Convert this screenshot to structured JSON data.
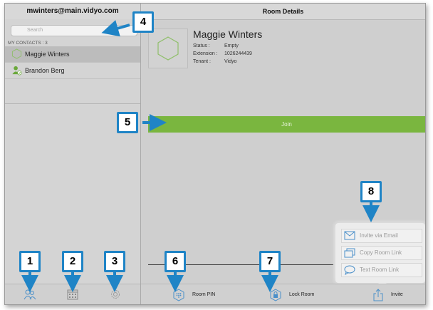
{
  "sidebar": {
    "account": "mwinters@main.vidyo.com",
    "search_placeholder": "Search",
    "contacts_header": "MY CONTACTS : 3",
    "contacts": [
      {
        "name": "Maggie Winters"
      },
      {
        "name": "Brandon Berg"
      }
    ],
    "tab_icons": [
      "contacts-icon",
      "calendar-icon",
      "settings-icon"
    ]
  },
  "main": {
    "title": "Room Details",
    "room_name": "Maggie Winters",
    "info": [
      {
        "label": "Status :",
        "value": "Empty"
      },
      {
        "label": "Extension :",
        "value": "1026244439"
      },
      {
        "label": "Tenant :",
        "value": "Vidyo"
      }
    ],
    "join_label": "Join",
    "toolbar": {
      "room_pin": "Room PIN",
      "lock_room": "Lock Room",
      "invite": "Invite"
    },
    "invite_menu": [
      "Invite via Email",
      "Copy Room Link",
      "Text Room Link"
    ]
  },
  "callouts": [
    "1",
    "2",
    "3",
    "4",
    "5",
    "6",
    "7",
    "8"
  ],
  "colors": {
    "accent": "#1f84c6",
    "join": "#7ab63f"
  }
}
